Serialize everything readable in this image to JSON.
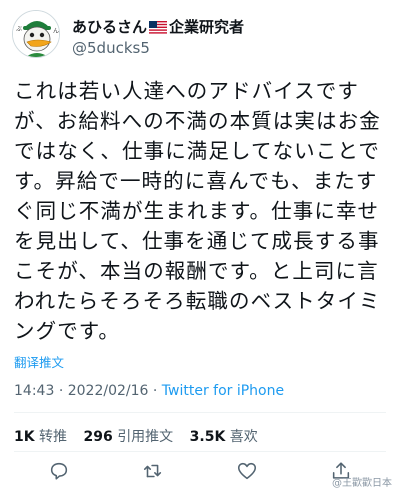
{
  "tweet": {
    "author": {
      "display_name": "あひるさん",
      "name_suffix": "企業研究者",
      "flag_icon": "us-flag-icon",
      "handle": "@5ducks5",
      "avatar_icon": "duck-avatar-icon"
    },
    "text": "これは若い人達へのアドバイスです\nが、お給料への不満の本質は実はお金\nではなく、仕事に満足してないことで\nす。昇給で一時的に喜んでも、またす\nぐ同じ不満が生まれます。仕事に幸せ\nを見出して、仕事を通じて成長する事\nこそが、本当の報酬です。と上司に言\nわれたらそろそろ転職のベストタイミ\nングです。",
    "translate_label": "翻译推文",
    "time": "14:43",
    "separator": "·",
    "date": "2022/02/16",
    "source": "Twitter for iPhone",
    "stats": {
      "retweets_count": "1K",
      "retweets_label": "转推",
      "quotes_count": "296",
      "quotes_label": "引用推文",
      "likes_count": "3.5K",
      "likes_label": "喜欢"
    },
    "actions": [
      "reply-icon",
      "retweet-icon",
      "like-icon",
      "share-icon"
    ]
  },
  "watermark": "@王歡歡日本",
  "colors": {
    "accent": "#1d9bf0",
    "text": "#0f1419",
    "secondary": "#536471",
    "divider": "#eff3f4"
  }
}
